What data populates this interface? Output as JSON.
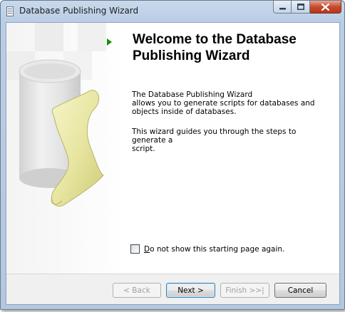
{
  "window": {
    "title": "Database Publishing Wizard",
    "icon": "database-app-icon",
    "caption_buttons": [
      "minimize-icon",
      "maximize-icon",
      "close-icon"
    ]
  },
  "main": {
    "heading": "Welcome to the Database Publishing Wizard",
    "paragraph1": "The Database Publishing Wizard\nallows you to generate scripts for databases and\nobjects inside of databases.",
    "paragraph2": "This wizard guides you through the steps to generate a\nscript.",
    "checkbox": {
      "accel": "D",
      "label_rest": "o not show this starting page again.",
      "checked": false
    }
  },
  "buttons": {
    "back": "< Back",
    "next": "Next >",
    "finish": "Finish >>|",
    "cancel": "Cancel"
  },
  "colors": {
    "arrow": "#1f8a12",
    "scroll": "#e8e6a2",
    "cylinder": "#d8d8d8"
  }
}
